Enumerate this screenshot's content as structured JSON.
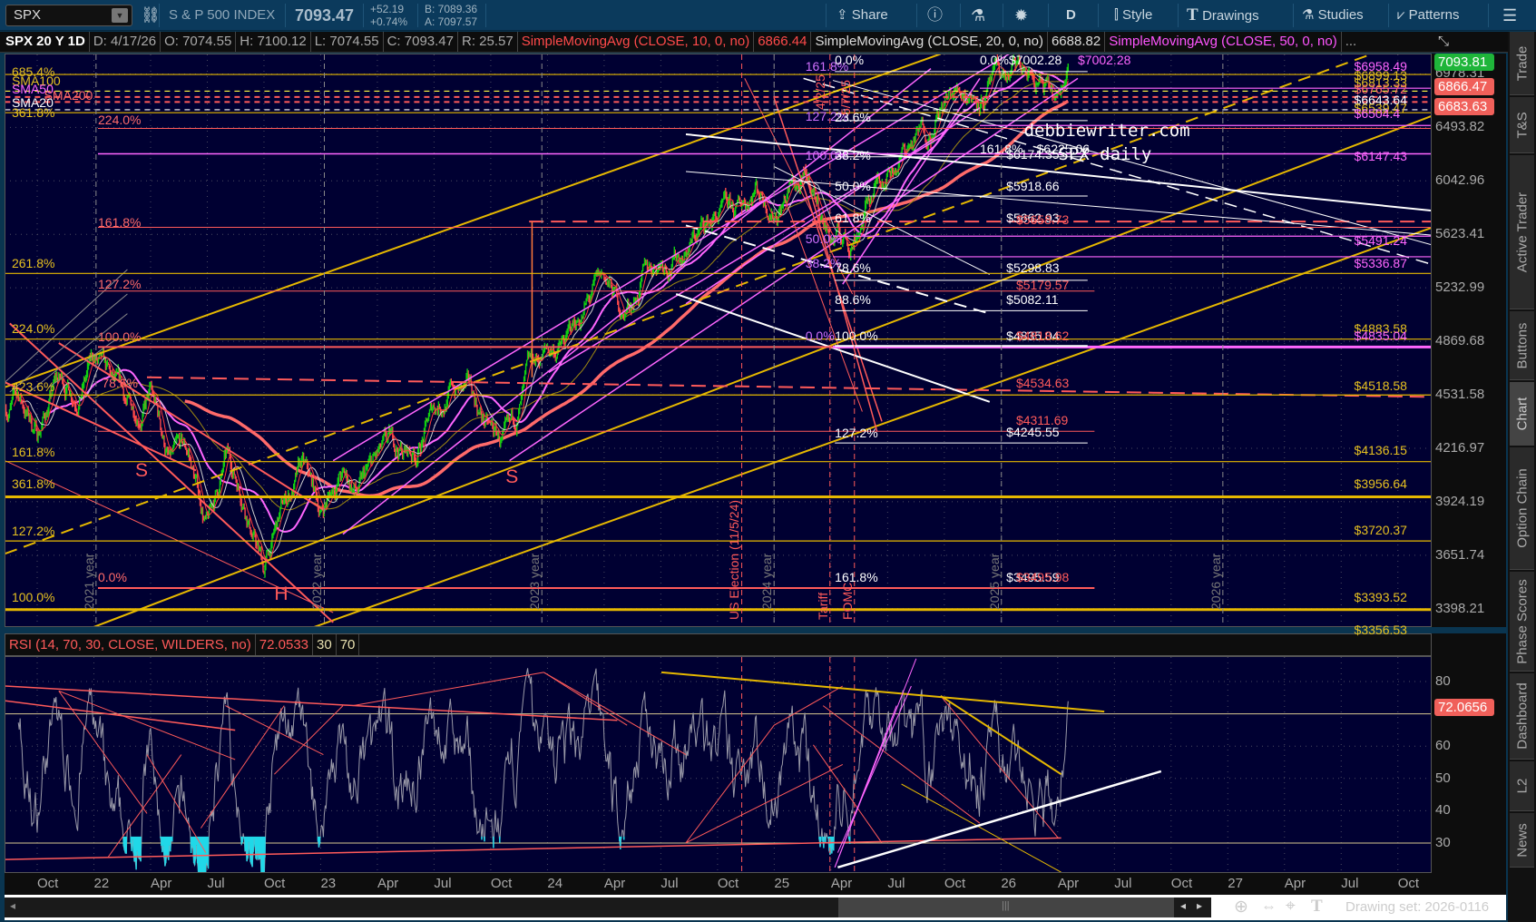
{
  "toolbar": {
    "symbol": "SPX",
    "description": "S & P 500 INDEX",
    "last": "7093.47",
    "change": "+52.19",
    "change_pct": "+0.74%",
    "bid": "B: 7089.36",
    "ask": "A: 7097.57",
    "share": "Share",
    "aggregation": "D",
    "style": "Style",
    "drawings": "Drawings",
    "studies": "Studies",
    "patterns": "Patterns"
  },
  "info_bar": {
    "chart_id": "SPX 20 Y 1D",
    "date": "D: 4/17/26",
    "open": "O: 7074.55",
    "high": "H: 7100.12",
    "low": "L: 7074.55",
    "close": "C: 7093.47",
    "range": "R: 25.57",
    "sma10_label": "SimpleMovingAvg (CLOSE, 10, 0, no)",
    "sma10_value": "6866.44",
    "sma20_label": "SimpleMovingAvg (CLOSE, 20, 0, no)",
    "sma20_value": "6688.82",
    "sma50_label": "SimpleMovingAvg (CLOSE, 50, 0, no)",
    "more": "..."
  },
  "price_axis": {
    "ticks": [
      "6978.31",
      "6493.82",
      "6042.96",
      "5623.41",
      "5232.99",
      "4869.68",
      "4531.58",
      "4216.97",
      "3924.19",
      "3651.74",
      "3398.21"
    ],
    "badges": [
      {
        "text": "7093.81",
        "color": "#1fb53a"
      },
      {
        "text": "6866.47",
        "color": "#f0605a"
      },
      {
        "text": "6683.63",
        "color": "#f0605a"
      }
    ]
  },
  "rsi": {
    "label": "RSI (14, 70, 30, CLOSE, WILDERS, no)",
    "value": "72.0533",
    "oversold": "30",
    "overbought": "70",
    "ticks": [
      "80",
      "60",
      "50",
      "40",
      "30"
    ],
    "badge": "72.0656"
  },
  "time_axis": [
    "Oct",
    "22",
    "Apr",
    "Jul",
    "Oct",
    "23",
    "Apr",
    "Jul",
    "Oct",
    "24",
    "Apr",
    "Jul",
    "Oct",
    "25",
    "Apr",
    "Jul",
    "Oct",
    "26",
    "Apr",
    "Jul",
    "Oct",
    "27",
    "Apr",
    "Jul",
    "Oct"
  ],
  "sidebar_tabs": [
    "Trade",
    "T&S",
    "Active Trader",
    "Buttons",
    "Chart",
    "Option Chain",
    "Phase Scores",
    "Dashboard",
    "L2",
    "News"
  ],
  "status": {
    "drawing_set": "Drawing set: 2026-0116"
  },
  "annotations": {
    "left_yellow": [
      "685.4%",
      "SMA100",
      "361.8%",
      "261.8%",
      "224.0%",
      "423.6%",
      "161.8%",
      "361.8%",
      "127.2%",
      "100.0%"
    ],
    "sma_tags": [
      "SMA50",
      "SMA200",
      "SMA20"
    ],
    "left_red": [
      "224.0%",
      "161.8%",
      "127.2%",
      "100.0%",
      "78.6%",
      "0.0%"
    ],
    "mid_magenta": [
      "161.8%",
      "127.2%",
      "100.0%",
      "50.0%",
      "38.2%",
      "0.0%"
    ],
    "mid_white": [
      "0.0%",
      "23.6%",
      "38.2%",
      "50.0%",
      "61.8%",
      "78.6%",
      "88.6%",
      "100.0%",
      "127.2%",
      "161.8%"
    ],
    "white_prices": [
      "0.0%$7002.28",
      "161.8%",
      "$6225.06",
      "$6174.35",
      "$5918.66",
      "$5662.93",
      "$5298.83",
      "$5082.11",
      "$4835.04",
      "$4245.55",
      "$3495.59"
    ],
    "red_prices": [
      "$5658.73",
      "$5179.57",
      "$4818.62",
      "$4534.63",
      "$4311.69",
      "$3495.98"
    ],
    "top_magenta_price": "$7002.28",
    "right_levels": [
      "$6958.49",
      "$6899.13",
      "$6813.33",
      "$6765.72",
      "$6643.64",
      "$6539.47",
      "$6504.4",
      "$6147.43",
      "$5491.24",
      "$5336.87",
      "$4883.58",
      "$4835.04",
      "$4518.58",
      "$4136.15",
      "$3956.64",
      "$3720.37",
      "$3393.52",
      "$3356.53"
    ],
    "year_markers": [
      "2021 year",
      "2022 year",
      "2023 year",
      "2024 year",
      "2025 year",
      "2026 year"
    ],
    "event_markers": [
      "US Election (11/5/24)",
      "Tariff",
      "FOMC",
      "4/2/25",
      "5/7/25"
    ],
    "pattern_letters": [
      "S",
      "H",
      "S"
    ],
    "watermark": [
      "debbiewriter.com",
      "SPX daily"
    ]
  },
  "chart_data": {
    "type": "candlestick",
    "symbol": "SPX",
    "period": "20 Y",
    "interval": "1D",
    "monthly_closes_start": "2021-08",
    "monthly_closes": [
      4520,
      4307,
      4605,
      4567,
      4766,
      4516,
      4374,
      4530,
      4132,
      4132,
      3785,
      4130,
      3955,
      3586,
      3872,
      4080,
      3840,
      4077,
      3970,
      4109,
      4169,
      4180,
      4450,
      4589,
      4508,
      4288,
      4194,
      4568,
      4770,
      4846,
      5096,
      5254,
      5036,
      5278,
      5460,
      5522,
      5648,
      5762,
      5705,
      6032,
      5882,
      6040,
      5955,
      5612,
      5569,
      5912,
      6205,
      6339,
      6460,
      6688,
      6840,
      6850,
      6900,
      6950,
      6880,
      6600,
      7093.47
    ],
    "last_close": 7093.47
  }
}
